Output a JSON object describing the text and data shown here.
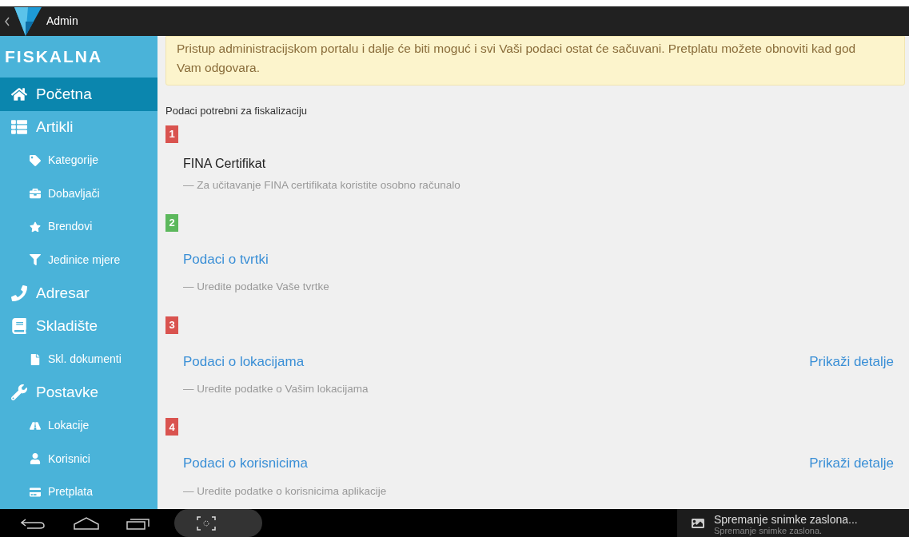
{
  "action_bar": {
    "title": "Admin"
  },
  "sidebar": {
    "logo": "FISKALNA",
    "items": [
      {
        "label": "Početna",
        "selected": true
      },
      {
        "label": "Artikli",
        "selected": false,
        "children": [
          {
            "label": "Kategorije",
            "selected": false
          },
          {
            "label": "Dobavljači",
            "selected": false
          },
          {
            "label": "Brendovi",
            "selected": false
          },
          {
            "label": "Jedinice mjere",
            "selected": false
          }
        ]
      },
      {
        "label": "Adresar",
        "selected": false
      },
      {
        "label": "Skladište",
        "selected": false,
        "children": [
          {
            "label": "Skl. dokumenti",
            "selected": false
          }
        ]
      },
      {
        "label": "Postavke",
        "selected": false,
        "children": [
          {
            "label": "Lokacije",
            "selected": false
          },
          {
            "label": "Korisnici",
            "selected": false
          },
          {
            "label": "Pretplata",
            "selected": false
          }
        ]
      }
    ]
  },
  "notice": "Pristup administracijskom portalu i dalje će biti moguć i svi Vaši podaci ostat će sačuvani. Pretplatu možete obnoviti kad god Vam odgovara.",
  "section_title": "Podaci potrebni za fiskalizaciju",
  "steps": [
    {
      "number": "1",
      "color": "#d9534f",
      "kind": "text",
      "title": "FINA Certifikat",
      "description": "— Za učitavanje FINA certifikata koristite osobno računalo"
    },
    {
      "number": "2",
      "color": "#5cb85c",
      "kind": "link",
      "title": "Podaci o tvrtki",
      "description": "— Uredite podatke Vaše tvrtke"
    },
    {
      "number": "3",
      "color": "#d9534f",
      "kind": "link",
      "title": "Podaci o lokacijama",
      "description": "— Uredite podatke o Vašim lokacijama",
      "action": "Prikaži detalje"
    },
    {
      "number": "4",
      "color": "#d9534f",
      "kind": "link",
      "title": "Podaci o korisnicima",
      "description": "— Uredite podatke o korisnicima aplikacije",
      "action": "Prikaži detalje"
    }
  ],
  "notification": {
    "title": "Spremanje snimke zaslona...",
    "subtitle": "Spremanje snimke zaslona."
  }
}
